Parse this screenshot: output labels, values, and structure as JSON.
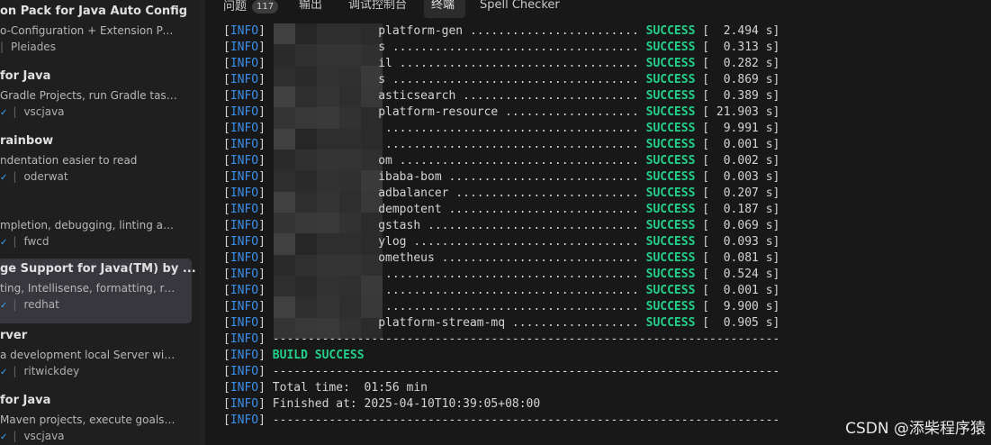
{
  "sidebar": {
    "extensions": [
      {
        "name": "on Pack for Java Auto Config",
        "description": "o-Configuration + Extension Pack ...",
        "publisher": "Pleiades",
        "verified": false,
        "selected": false
      },
      {
        "name": "for Java",
        "description": "Gradle Projects, run Gradle tasks ...",
        "publisher": "vscjava",
        "verified": true,
        "selected": false
      },
      {
        "name": "rainbow",
        "description": "ndentation easier to read",
        "publisher": "oderwat",
        "verified": true,
        "selected": false
      },
      {
        "name": "",
        "description": "mpletion, debugging, linting and ...",
        "publisher": "fwcd",
        "verified": true,
        "selected": false
      },
      {
        "name": "ge Support for Java(TM) by ...",
        "description": "ting, Intellisense, formatting, refac...",
        "publisher": "redhat",
        "verified": true,
        "selected": true
      },
      {
        "name": "rver",
        "description": "a development local Server with li...",
        "publisher": "ritwickdey",
        "verified": true,
        "selected": false
      },
      {
        "name": "for Java",
        "description": "Maven projects, execute goals, g...",
        "publisher": "vscjava",
        "verified": true,
        "selected": false
      }
    ]
  },
  "panel": {
    "tabs": [
      {
        "label": "问题",
        "badge": "117",
        "active": false
      },
      {
        "label": "输出",
        "badge": "",
        "active": false
      },
      {
        "label": "调试控制台",
        "badge": "",
        "active": false
      },
      {
        "label": "终端",
        "badge": "",
        "active": true
      },
      {
        "label": "Spell Checker",
        "badge": "",
        "active": false
      }
    ]
  },
  "terminal": {
    "level": "INFO",
    "lines": [
      {
        "module": "platform-gen ........................",
        "status": "SUCCESS",
        "time": "[  2.494 s]"
      },
      {
        "module": "s ...................................",
        "status": "SUCCESS",
        "time": "[  0.313 s]"
      },
      {
        "module": "il ..................................",
        "status": "SUCCESS",
        "time": "[  0.282 s]"
      },
      {
        "module": "s ...................................",
        "status": "SUCCESS",
        "time": "[  0.869 s]"
      },
      {
        "module": "asticsearch .........................",
        "status": "SUCCESS",
        "time": "[  0.389 s]"
      },
      {
        "module": "platform-resource ...................",
        "status": "SUCCESS",
        "time": "[ 21.903 s]"
      },
      {
        "module": " ....................................",
        "status": "SUCCESS",
        "time": "[  9.991 s]"
      },
      {
        "module": " ....................................",
        "status": "SUCCESS",
        "time": "[  0.001 s]"
      },
      {
        "module": "om ..................................",
        "status": "SUCCESS",
        "time": "[  0.002 s]"
      },
      {
        "module": "ibaba-bom ...........................",
        "status": "SUCCESS",
        "time": "[  0.003 s]"
      },
      {
        "module": "adbalancer ..........................",
        "status": "SUCCESS",
        "time": "[  0.207 s]"
      },
      {
        "module": "dempotent ...........................",
        "status": "SUCCESS",
        "time": "[  0.187 s]"
      },
      {
        "module": "gstash ..............................",
        "status": "SUCCESS",
        "time": "[  0.069 s]"
      },
      {
        "module": "ylog ................................",
        "status": "SUCCESS",
        "time": "[  0.093 s]"
      },
      {
        "module": "ometheus ............................",
        "status": "SUCCESS",
        "time": "[  0.081 s]"
      },
      {
        "module": " ....................................",
        "status": "SUCCESS",
        "time": "[  0.524 s]"
      },
      {
        "module": " ....................................",
        "status": "SUCCESS",
        "time": "[  0.001 s]"
      },
      {
        "module": " ....................................",
        "status": "SUCCESS",
        "time": "[  9.900 s]"
      },
      {
        "module": "platform-stream-mq ..................",
        "status": "SUCCESS",
        "time": "[  0.905 s]"
      }
    ],
    "separator": "------------------------------------------------------------------------",
    "build_result": "BUILD SUCCESS",
    "total_time": "Total time:  01:56 min",
    "finished_at": "Finished at: 2025-04-10T10:39:05+08:00"
  },
  "watermark": "CSDN @添柴程序猿",
  "colors": {
    "info": "#3b8eea",
    "success": "#23d18b",
    "background": "#181818",
    "sidebar": "#1f1f1f",
    "selected": "#37373d"
  }
}
